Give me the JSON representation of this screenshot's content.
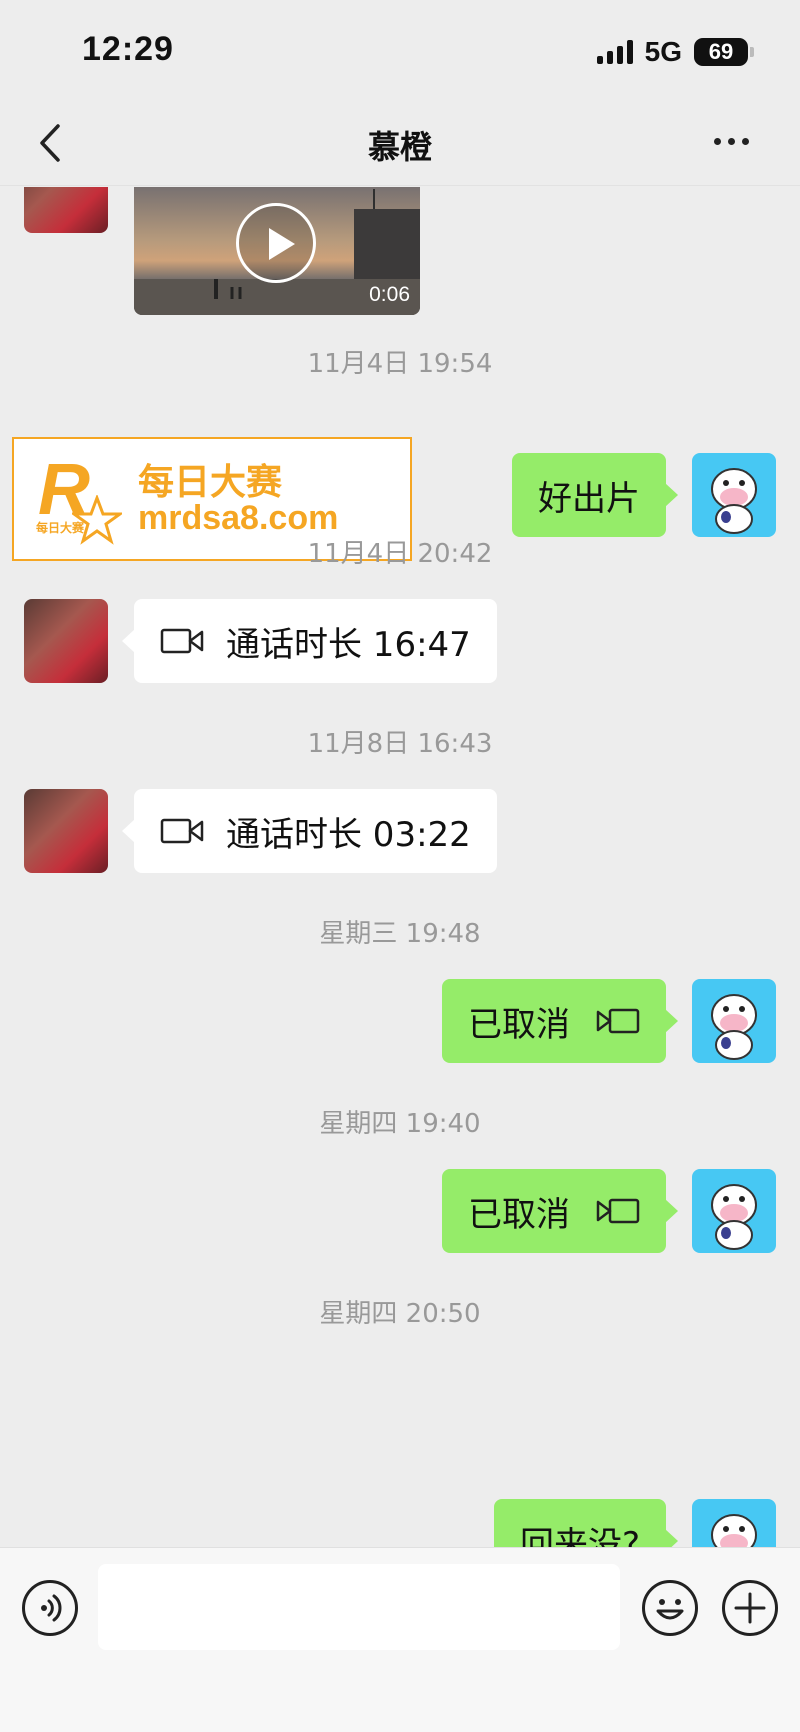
{
  "status_bar": {
    "time": "12:29",
    "network": "5G",
    "battery": "69"
  },
  "nav": {
    "title": "慕橙"
  },
  "messages": {
    "video": {
      "duration": "0:06"
    },
    "ts1": "11月4日 19:54",
    "reply1": "好出片",
    "ad": {
      "logo": "R",
      "logo_sub": "每日大赛",
      "title": "每日大赛",
      "url": "mrdsa8.com"
    },
    "ts2": "11月4日 20:42",
    "call1": "通话时长 16:47",
    "ts3": "11月8日 16:43",
    "call2": "通话时长 03:22",
    "ts4": "星期三 19:48",
    "cancel1": "已取消",
    "ts5": "星期四 19:40",
    "cancel2": "已取消",
    "ts6": "星期四 20:50",
    "partial": "回来没?"
  },
  "input": {
    "value": ""
  },
  "colors": {
    "bubble_green": "#95ec69",
    "ad_orange": "#f5a623",
    "avatar_blue": "#47c8f3"
  }
}
